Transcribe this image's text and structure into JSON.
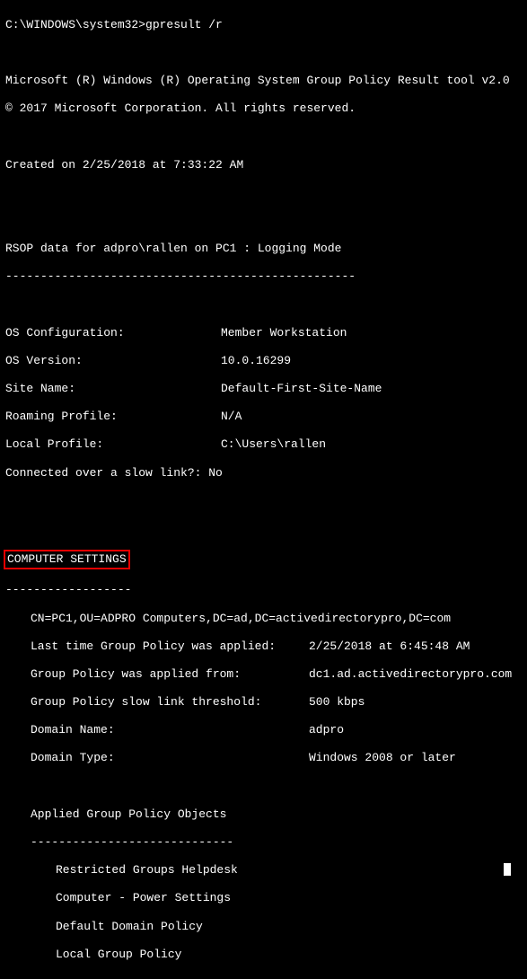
{
  "prompt_path": "C:\\WINDOWS\\system32>",
  "command": "gpresult /r",
  "header_line": "Microsoft (R) Windows (R) Operating System Group Policy Result tool v2.0",
  "copyright": "© 2017 Microsoft Corporation. All rights reserved.",
  "created_on": "Created on ‎2/‎25/‎2018 at 7:33:22 AM",
  "rsop_line": "RSOP data for adpro\\rallen on PC1 : Logging Mode",
  "rsop_dashes": "--------------------------------------------------",
  "os_info": {
    "os_config_label": "OS Configuration:",
    "os_config_value": "Member Workstation",
    "os_version_label": "OS Version:",
    "os_version_value": "10.0.16299",
    "site_name_label": "Site Name:",
    "site_name_value": "Default-First-Site-Name",
    "roaming_profile_label": "Roaming Profile:",
    "roaming_profile_value": "N/A",
    "local_profile_label": "Local Profile:",
    "local_profile_value": "C:\\Users\\rallen",
    "slow_link_label": "Connected over a slow link?:",
    "slow_link_value": "No"
  },
  "computer_settings_heading": "COMPUTER SETTINGS",
  "computer_settings_dashes": "------------------",
  "comp": {
    "cn": "CN=PC1,OU=ADPRO Computers,DC=ad,DC=activedirectorypro,DC=com",
    "last_applied_label": "Last time Group Policy was applied:",
    "last_applied_value": "2/25/2018 at 6:45:48 AM",
    "applied_from_label": "Group Policy was applied from:",
    "applied_from_value": "dc1.ad.activedirectorypro.com",
    "slow_link_threshold_label": "Group Policy slow link threshold:",
    "slow_link_threshold_value": "500 kbps",
    "domain_name_label": "Domain Name:",
    "domain_name_value": "adpro",
    "domain_type_label": "Domain Type:",
    "domain_type_value": "Windows 2008 or later"
  },
  "applied_gpo_heading": "Applied Group Policy Objects",
  "applied_gpo_dashes": "-----------------------------",
  "gpos": {
    "g0": "Restricted Groups Helpdesk",
    "g1": "Computer - Power Settings",
    "g2": "Default Domain Policy",
    "g3": "Local Group Policy"
  }
}
